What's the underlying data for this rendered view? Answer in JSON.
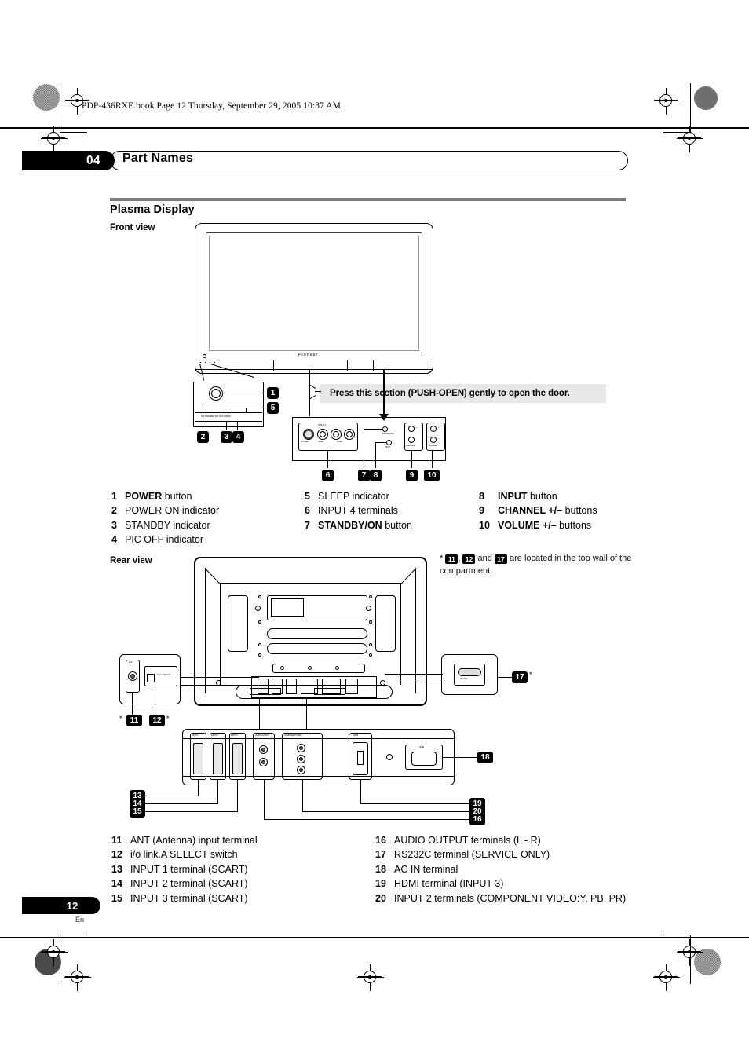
{
  "header": {
    "book_line": "PDP-436RXE.book  Page 12  Thursday, September 29, 2005  10:37 AM"
  },
  "chapter": {
    "number": "04",
    "title": "Part Names"
  },
  "section": {
    "title": "Plasma Display",
    "front_view_label": "Front view",
    "rear_view_label": "Rear view"
  },
  "banner": {
    "text": "Press this section (PUSH-OPEN) gently to open the door."
  },
  "front_list": {
    "col1": [
      {
        "num": "1",
        "bold": "POWER",
        "rest": " button"
      },
      {
        "num": "2",
        "bold": "",
        "rest": "POWER ON indicator"
      },
      {
        "num": "3",
        "bold": "",
        "rest": "STANDBY indicator"
      },
      {
        "num": "4",
        "bold": "",
        "rest": "PIC OFF indicator"
      }
    ],
    "col2": [
      {
        "num": "5",
        "bold": "",
        "rest": "SLEEP indicator"
      },
      {
        "num": "6",
        "bold": "",
        "rest": "INPUT 4 terminals"
      },
      {
        "num": "7",
        "bold": "STANDBY/ON",
        "rest": " button"
      }
    ],
    "col3": [
      {
        "num": "8",
        "bold": "INPUT",
        "rest": " button"
      },
      {
        "num": "9",
        "bold": "CHANNEL +/–",
        "rest": " buttons"
      },
      {
        "num": "10",
        "bold": "VOLUME +/–",
        "rest": " buttons"
      }
    ]
  },
  "footnote": {
    "prefix": "*",
    "marks": [
      "11",
      "12",
      "17"
    ],
    "sep1": ",",
    "sep2": "and",
    "text": "are located in the top wall of the compartment."
  },
  "rear_list": {
    "col1": [
      {
        "num": "11",
        "rest": "ANT (Antenna) input terminal"
      },
      {
        "num": "12",
        "rest": "i/o link.A SELECT switch"
      },
      {
        "num": "13",
        "rest": "INPUT 1 terminal (SCART)"
      },
      {
        "num": "14",
        "rest": "INPUT 2 terminal (SCART)"
      },
      {
        "num": "15",
        "rest": "INPUT 3 terminal (SCART)"
      }
    ],
    "col2": [
      {
        "num": "16",
        "rest": "AUDIO OUTPUT terminals (L - R)"
      },
      {
        "num": "17",
        "rest": "RS232C terminal (SERVICE ONLY)"
      },
      {
        "num": "18",
        "rest": "AC IN terminal"
      },
      {
        "num": "19",
        "rest": "HDMI terminal (INPUT 3)"
      },
      {
        "num": "20",
        "rest": "INPUT 2 terminals (COMPONENT VIDEO:Y, PB, PR)"
      }
    ]
  },
  "callouts": {
    "front_panel": [
      "1",
      "5",
      "2",
      "3",
      "4"
    ],
    "control_panel": [
      "6",
      "7",
      "8",
      "9",
      "10"
    ],
    "rear_left": [
      "11",
      "12"
    ],
    "rear_right": [
      "17"
    ],
    "rear_bottom_left": [
      "13",
      "14",
      "15"
    ],
    "rear_bottom_right": [
      "19",
      "20",
      "16"
    ],
    "rear_ac": [
      "18"
    ]
  },
  "artwork_labels": {
    "brand": "Pioneer",
    "indicator_strip": "ON  STANDBY   PIC OFF   SLEEP",
    "input4_title": "INPUT 4",
    "input4_jacks": [
      "S-VIDEO",
      "VIDEO",
      "AUDIO"
    ],
    "standby_on": "STANDBY/ON",
    "input_btn": "INPUT",
    "channel": "CHANNEL",
    "volume": "VOLUME",
    "plus": "+",
    "minus": "–",
    "rs232c": "RS-232C",
    "ac_in": "AC IN",
    "ant": "ANT",
    "io_select": "i/o link.A SELECT",
    "scart1": "INPUT 1",
    "scart2": "INPUT 2",
    "scart3": "INPUT 3",
    "audio_output": "AUDIO OUTPUT",
    "component": "COMPONENT VIDEO",
    "hdmi": "HDMI"
  },
  "page": {
    "number": "12",
    "lang": "En"
  },
  "colors": {
    "ink": "#000000",
    "banner_bg": "#e8e8e8",
    "rule_gray": "#7b7b7b"
  }
}
